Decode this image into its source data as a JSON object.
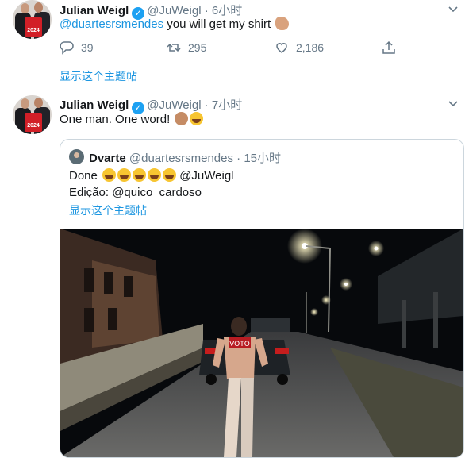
{
  "tweets": [
    {
      "name": "Julian Weigl",
      "handle": "@JuWeigl",
      "time": "· 6小时",
      "avatar_shirt_text": "2024",
      "reply_to": "@duartesrsmendes",
      "text": " you will get my shirt ",
      "emoji": "flexed-biceps",
      "replies": "39",
      "retweets": "295",
      "likes": "2,186",
      "thread_link": "显示这个主题帖"
    },
    {
      "name": "Julian Weigl",
      "handle": "@JuWeigl",
      "time": "· 7小时",
      "avatar_shirt_text": "2024",
      "text": "One man. One word! ",
      "emoji": [
        "clapping-hands",
        "face-with-tears-of-joy"
      ],
      "quote": {
        "name": "Dvarte",
        "handle": "@duartesrsmendes",
        "time": "· 15小时",
        "line1_text": "Done ",
        "line1_emoji": [
          "face-with-tears-of-joy",
          "face-with-tears-of-joy",
          "face-with-tears-of-joy",
          "face-with-tears-of-joy",
          "face-with-tears-of-joy"
        ],
        "line1_mention": "@JuWeigl",
        "line2": "Edição: @quico_cardoso",
        "thread_link": "显示这个主题帖",
        "media": "night street video: shirtless man running behind a car with open trunk, street lamps",
        "shirt_text": "VOTO"
      }
    }
  ],
  "colors": {
    "link": "#1b95e0",
    "verified": "#1da1f2",
    "muted": "#657786",
    "border": "#e6ecf0"
  }
}
